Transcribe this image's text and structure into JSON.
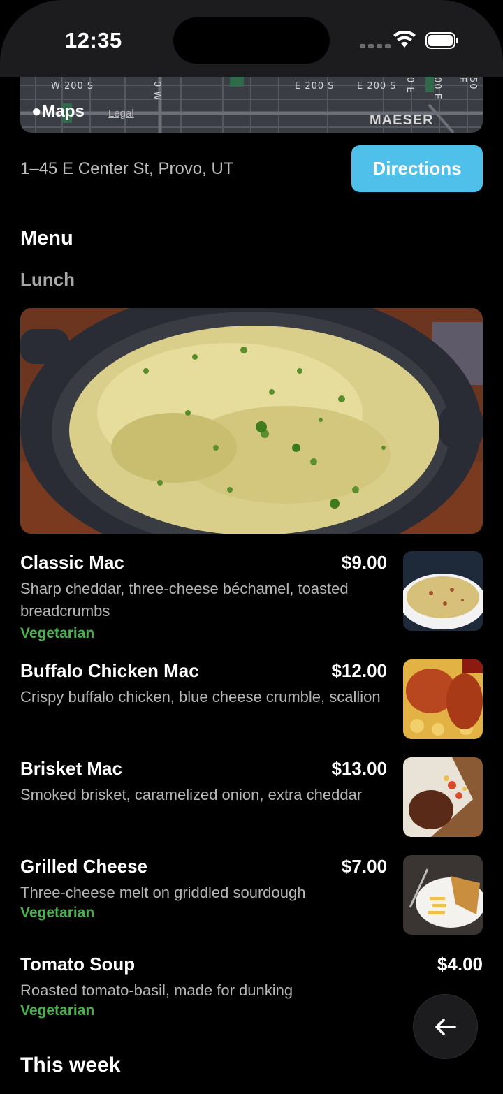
{
  "status_bar": {
    "time": "12:35"
  },
  "map": {
    "labels": [
      "W 200 S",
      "0 W",
      "E 200 S",
      "E 200 S",
      "0 E",
      "00 E",
      "50 E"
    ],
    "brand": "Maps",
    "legal": "Legal",
    "district": "MAESER"
  },
  "location": {
    "address": "1–45 E Center St, Provo, UT",
    "directions_label": "Directions"
  },
  "menu": {
    "title": "Menu",
    "section": "Lunch",
    "items": [
      {
        "name": "Classic Mac",
        "price": "$9.00",
        "description": "Sharp cheddar, three-cheese béchamel, toasted breadcrumbs",
        "tag": "Vegetarian"
      },
      {
        "name": "Buffalo Chicken Mac",
        "price": "$12.00",
        "description": "Crispy buffalo chicken, blue cheese crumble, scallion",
        "tag": ""
      },
      {
        "name": "Brisket Mac",
        "price": "$13.00",
        "description": "Smoked brisket, caramelized onion, extra cheddar",
        "tag": ""
      },
      {
        "name": "Grilled Cheese",
        "price": "$7.00",
        "description": "Three-cheese melt on griddled sourdough",
        "tag": "Vegetarian"
      },
      {
        "name": "Tomato Soup",
        "price": "$4.00",
        "description": "Roasted tomato-basil, made for dunking",
        "tag": "Vegetarian"
      }
    ],
    "next_section": "This week"
  },
  "colors": {
    "accent": "#4ec0e9",
    "vegetarian": "#4caf50",
    "background": "#000000"
  },
  "icons": {
    "back": "arrow-left-icon",
    "wifi": "wifi-icon",
    "battery": "battery-icon",
    "apple": "apple-logo-icon"
  }
}
